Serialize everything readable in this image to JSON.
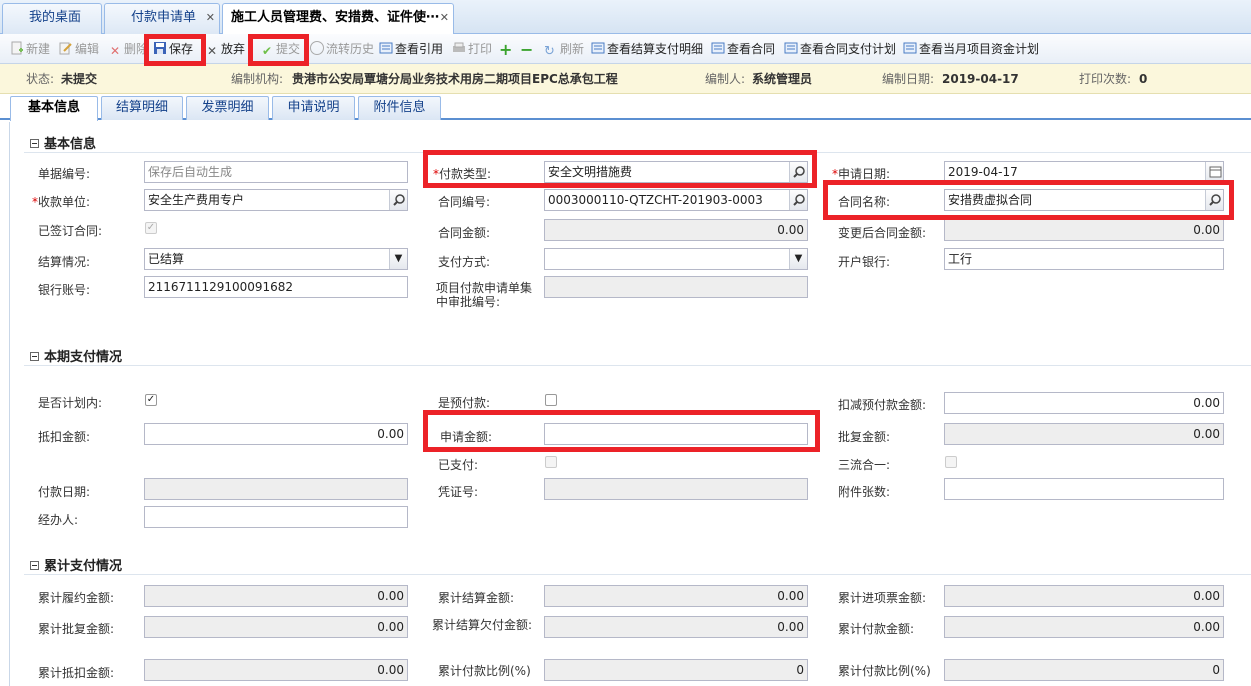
{
  "tabs": [
    {
      "label": "我的桌面"
    },
    {
      "label": "付款申请单"
    },
    {
      "label": "施工人员管理费、安措费、证件使⋯"
    }
  ],
  "toolbar": {
    "new": "新建",
    "edit": "编辑",
    "delete": "删除",
    "save": "保存",
    "discard": "放弃",
    "submit": "提交",
    "flow_history": "流转历史",
    "view_ref": "查看引用",
    "print": "打印",
    "refresh": "刷新",
    "view_settlement": "查看结算支付明细",
    "view_contract": "查看合同",
    "view_contract_plan": "查看合同支付计划",
    "view_month_plan": "查看当月项目资金计划"
  },
  "status": {
    "state_label": "状态:",
    "state_value": "未提交",
    "org_label": "编制机构:",
    "org_value": "贵港市公安局覃塘分局业务技术用房二期项目EPC总承包工程",
    "author_label": "编制人:",
    "author_value": "系统管理员",
    "date_label": "编制日期:",
    "date_value": "2019-04-17",
    "print_label": "打印次数:",
    "print_value": "0"
  },
  "subtabs": [
    "基本信息",
    "结算明细",
    "发票明细",
    "申请说明",
    "附件信息"
  ],
  "basic": {
    "title": "基本信息",
    "doc_no_label": "单据编号:",
    "doc_no_placeholder": "保存后自动生成",
    "pay_type_label": "付款类型:",
    "pay_type_value": "安全文明措施费",
    "apply_date_label": "申请日期:",
    "apply_date_value": "2019-04-17",
    "payee_label": "收款单位:",
    "payee_value": "安全生产费用专户",
    "contract_no_label": "合同编号:",
    "contract_no_value": "0003000110-QTZCHT-201903-0003",
    "contract_name_label": "合同名称:",
    "contract_name_value": "安措费虚拟合同",
    "signed_label": "已签订合同:",
    "contract_amount_label": "合同金额:",
    "contract_amount_value": "0.00",
    "changed_amount_label": "变更后合同金额:",
    "changed_amount_value": "0.00",
    "settle_label": "结算情况:",
    "settle_value": "已结算",
    "pay_method_label": "支付方式:",
    "pay_method_value": "",
    "bank_label": "开户银行:",
    "bank_value": "工行",
    "account_label": "银行账号:",
    "account_value": "2116711129100091682",
    "central_no_label": "项目付款申请单集中审批编号:",
    "central_no_value": ""
  },
  "current": {
    "title": "本期支付情况",
    "in_plan_label": "是否计划内:",
    "prepay_label": "是预付款:",
    "deduct_prepay_label": "扣减预付款金额:",
    "deduct_prepay_value": "0.00",
    "offset_label": "抵扣金额:",
    "offset_value": "0.00",
    "apply_amount_label": "申请金额:",
    "apply_amount_value": "",
    "approved_label": "批复金额:",
    "approved_value": "0.00",
    "paid_label": "已支付:",
    "three_label": "三流合一:",
    "pay_date_label": "付款日期:",
    "voucher_label": "凭证号:",
    "attach_label": "附件张数:",
    "handler_label": "经办人:"
  },
  "cumulative": {
    "title": "累计支付情况",
    "perf_label": "累计履约金额:",
    "perf_value": "0.00",
    "settle_label": "累计结算金额:",
    "settle_value": "0.00",
    "invoice_label": "累计进项票金额:",
    "invoice_value": "0.00",
    "approved_label": "累计批复金额:",
    "approved_value": "0.00",
    "unpaid_label": "累计结算欠付金额:",
    "unpaid_value": "0.00",
    "paid_label": "累计付款金额:",
    "paid_value": "0.00",
    "deduct_label": "累计抵扣金额:",
    "deduct_value": "0.00",
    "ratio_label": "累计付款比例(%)",
    "ratio_value": "0",
    "ratio2_label": "累计付款比例(%)",
    "ratio2_value": "0"
  },
  "colors": {
    "highlight": "#ec2228",
    "tab_border": "#99bbe8",
    "status_bg": "#fbf7dc"
  }
}
